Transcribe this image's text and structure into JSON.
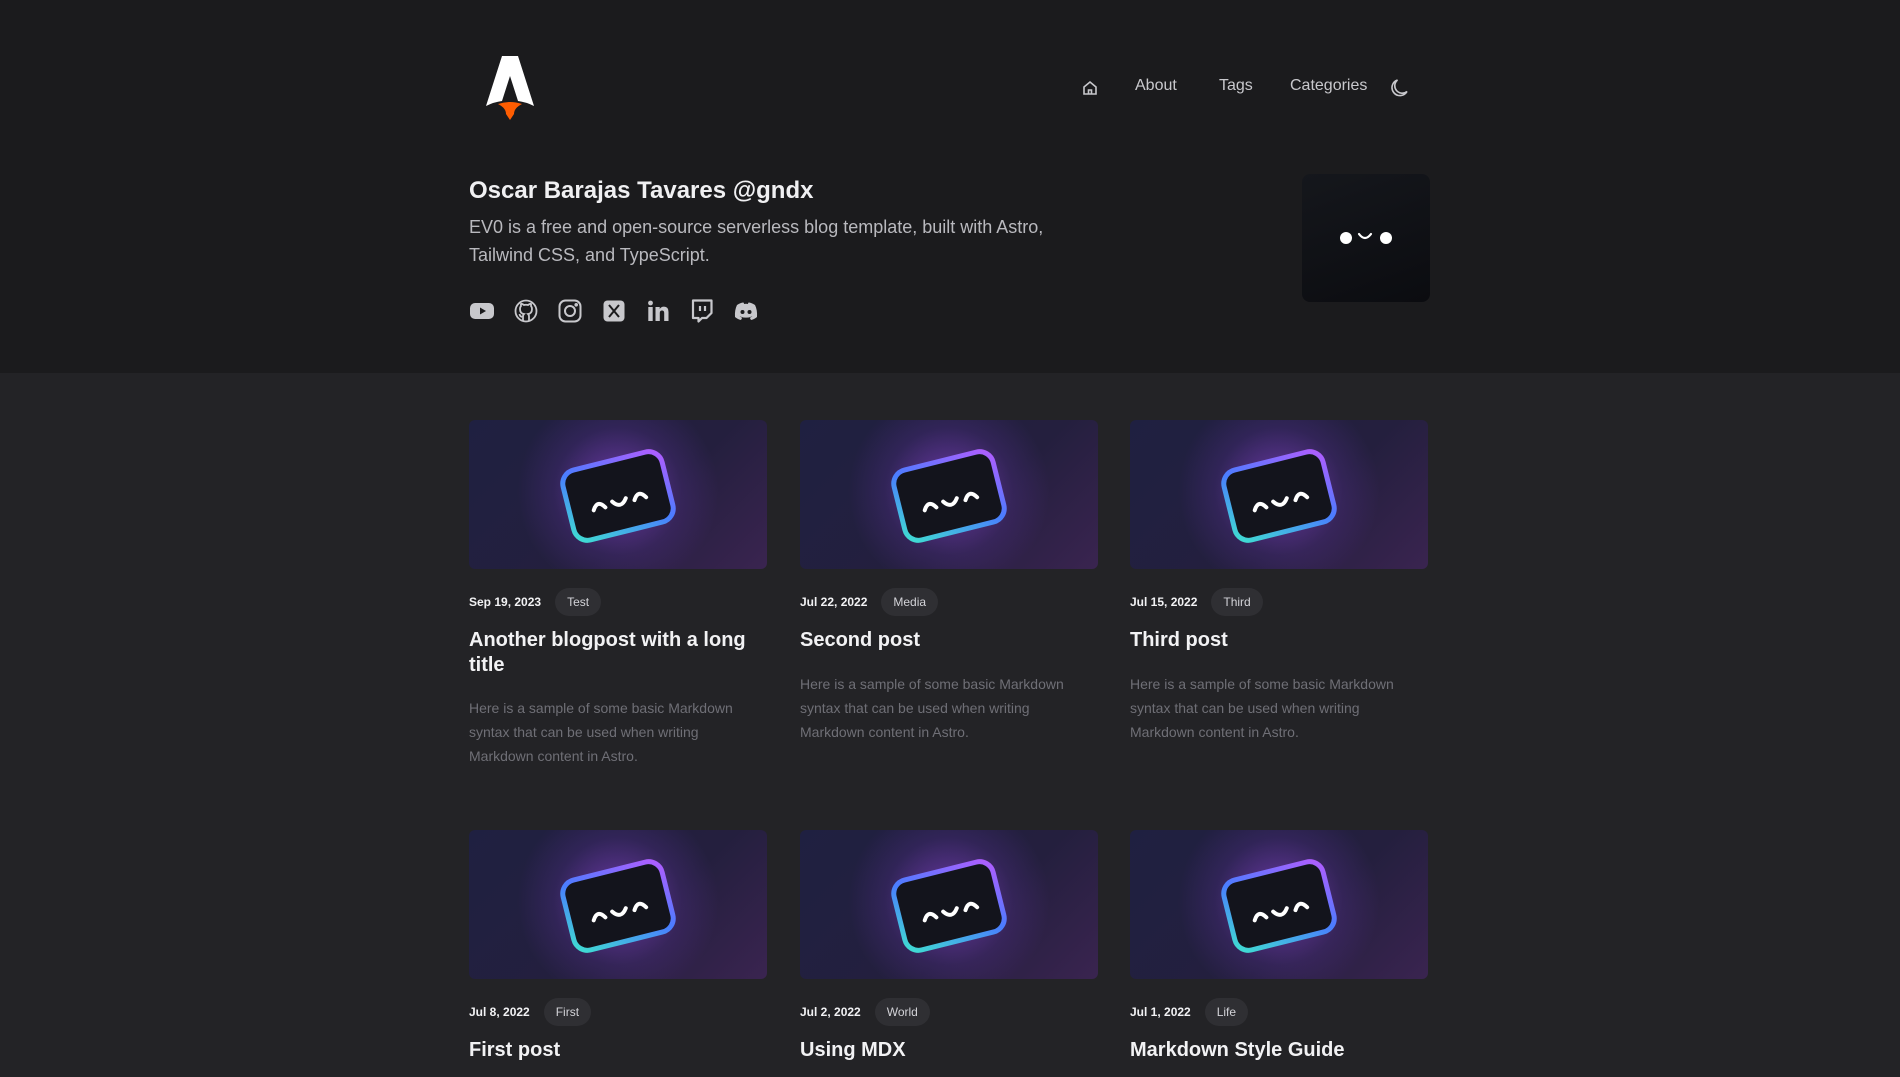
{
  "header": {
    "nav": {
      "about": "About",
      "tags": "Tags",
      "categories": "Categories"
    },
    "icons": {
      "logo": "astro-logo-icon",
      "home": "home-icon",
      "theme": "moon-icon"
    }
  },
  "profile": {
    "name": "Oscar Barajas Tavares @gndx",
    "bio": "EV0 is a free and open-source serverless blog template, built with Astro, Tailwind CSS, and TypeScript.",
    "socials": [
      "youtube-icon",
      "github-icon",
      "instagram-icon",
      "x-icon",
      "linkedin-icon",
      "twitch-icon",
      "discord-icon"
    ]
  },
  "posts": [
    {
      "date": "Sep 19, 2023",
      "tag": "Test",
      "title": "Another blogpost with a long title",
      "excerpt": "Here is a sample of some basic Markdown syntax that can be used when writing Markdown content in Astro."
    },
    {
      "date": "Jul 22, 2022",
      "tag": "Media",
      "title": "Second post",
      "excerpt": "Here is a sample of some basic Markdown syntax that can be used when writing Markdown content in Astro."
    },
    {
      "date": "Jul 15, 2022",
      "tag": "Third",
      "title": "Third post",
      "excerpt": "Here is a sample of some basic Markdown syntax that can be used when writing Markdown content in Astro."
    },
    {
      "date": "Jul 8, 2022",
      "tag": "First",
      "title": "First post"
    },
    {
      "date": "Jul 2, 2022",
      "tag": "World",
      "title": "Using MDX"
    },
    {
      "date": "Jul 1, 2022",
      "tag": "Life",
      "title": "Markdown Style Guide"
    }
  ],
  "colors": {
    "header_bg": "#1b1b1d",
    "page_bg": "#232326",
    "accent_orange": "#ff5d01"
  }
}
